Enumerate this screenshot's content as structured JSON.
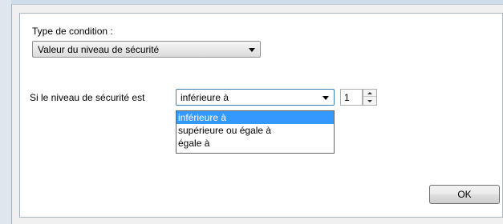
{
  "condition_type": {
    "label": "Type de condition :",
    "selected": "Valeur du niveau de sécurité"
  },
  "security_level": {
    "label": "Si le niveau de sécurité est",
    "operator_selected": "inférieure à",
    "operator_options": [
      "inférieure à",
      "supérieure ou égale à",
      "égale à"
    ],
    "value": "1"
  },
  "buttons": {
    "ok_label": "OK"
  },
  "colors": {
    "selection": "#3399ff",
    "panel_bg": "#ffffff",
    "dialog_bg": "#f0f0f0"
  },
  "icons": {
    "combo_arrow": "chevron-down-icon",
    "spin_up": "spin-up-icon",
    "spin_down": "spin-down-icon"
  }
}
